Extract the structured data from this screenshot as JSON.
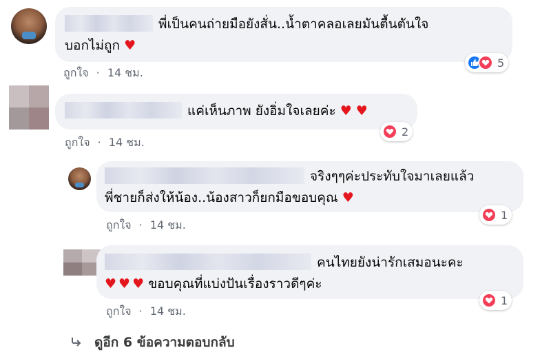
{
  "comments": [
    {
      "text_line1": "พี่เป็นคนถ่ายมือยังสั่น..น้ำตาคลอเลยมันตื้นตันใจ",
      "text_line2": "บอกไม่ถูก",
      "like_label": "ถูกใจ",
      "time": "14 ชม.",
      "reactions": [
        "like",
        "love"
      ],
      "reaction_count": "5"
    },
    {
      "text_line1": "แค่เห็นภาพ ยังอิ่มใจเลยค่ะ",
      "like_label": "ถูกใจ",
      "time": "14 ชม.",
      "reactions": [
        "love"
      ],
      "reaction_count": "2"
    },
    {
      "text_line1": "จริงๆๆค่ะประทับใจมาเลยแล้ว",
      "text_line2": "พี่ชายก็ส่งให้น้อง..น้องสาวก็ยกมือขอบคุณ",
      "like_label": "ถูกใจ",
      "time": "14 ชม.",
      "reactions": [
        "love"
      ],
      "reaction_count": "1"
    },
    {
      "text_line1": "คนไทยยังน่ารักเสมอนะคะ",
      "text_line2": "ขอบคุณที่แบ่งปันเรื่องราวดีๆค่ะ",
      "like_label": "ถูกใจ",
      "time": "14 ชม.",
      "reactions": [
        "love"
      ],
      "reaction_count": "1"
    }
  ],
  "separator": "·",
  "heart_glyph": "♥",
  "view_more_replies": "ดูอีก 6 ข้อความตอบกลับ",
  "colors": {
    "bubble": "#f0f2f5",
    "heart": "#e4151c",
    "like_blue": "#1877f2",
    "love_red": "#f33e58",
    "meta_gray": "#606770"
  }
}
